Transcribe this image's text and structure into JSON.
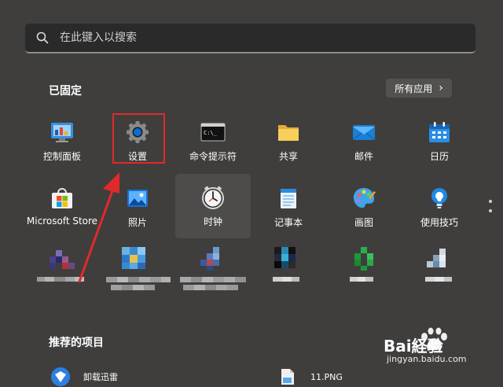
{
  "search": {
    "placeholder": "在此键入以搜索"
  },
  "pinned": {
    "title": "已固定",
    "all_apps_label": "所有应用",
    "all_apps_chevron": "›"
  },
  "apps": [
    {
      "label": "控制面板",
      "icon": "control-panel-icon"
    },
    {
      "label": "设置",
      "icon": "settings-gear-icon"
    },
    {
      "label": "命令提示符",
      "icon": "command-prompt-icon"
    },
    {
      "label": "共享",
      "icon": "folder-icon"
    },
    {
      "label": "邮件",
      "icon": "mail-icon"
    },
    {
      "label": "日历",
      "icon": "calendar-icon"
    },
    {
      "label": "Microsoft Store",
      "icon": "store-icon"
    },
    {
      "label": "照片",
      "icon": "photos-icon"
    },
    {
      "label": "时钟",
      "icon": "clock-icon"
    },
    {
      "label": "记事本",
      "icon": "notepad-icon"
    },
    {
      "label": "画图",
      "icon": "paint-palette-icon"
    },
    {
      "label": "使用技巧",
      "icon": "tips-bulb-icon"
    }
  ],
  "cmd_icon_text": "C:\\_",
  "recommended": {
    "title": "推荐的项目",
    "items": [
      {
        "label": "卸载迅雷"
      },
      {
        "label": "11.PNG"
      }
    ]
  },
  "watermark": {
    "brand": "Bai経验",
    "url": "jingyan.baidu.com"
  },
  "colors": {
    "accent": "#0078d4",
    "highlight_box": "#e02a2a",
    "arrow": "#e02a2a"
  }
}
